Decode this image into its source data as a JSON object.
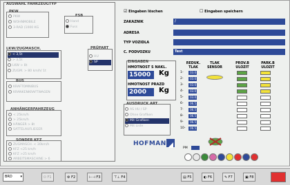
{
  "left_title": "AUSWAHL FAHRZEUGTYP",
  "pkw": {
    "title": "PKW",
    "items": [
      "PKW",
      "WOHNMOBILE",
      "3-RAD (1000 KG"
    ]
  },
  "fsb": {
    "title": "FSB",
    "items": [
      "Hand",
      "Fuss"
    ]
  },
  "lkw": {
    "title": "LKW/ZUGMASCH.",
    "items": [
      "< 3,5t",
      "> 3,5t",
      "LKW > 8t",
      "ZUGM. > 80 km/h/ 1t"
    ]
  },
  "pruefart": {
    "title": "PRÜFART",
    "items": [
      "HU",
      "SP"
    ]
  },
  "bus": {
    "title": "BUS",
    "items": [
      "KRAFTOMNIBUS",
      "KRANKENKRAFTWAGEN"
    ]
  },
  "anhaenger": {
    "title": "ANHÄNGERFAHRZEUG",
    "items": [
      "< 25km/h",
      "> 25km/h",
      "HÄNGER > 8t",
      "SATTELAUFLIEGER"
    ]
  },
  "sonder": {
    "title": "SONDER KFZ",
    "items": [
      "ZUGMASCH. < 30km/h",
      "KFZ <25 km/h",
      "KFZ >25 km/h",
      "ARBEITSMASCHINE > 6"
    ]
  },
  "checks": {
    "loeschen": "Eingaben löschen",
    "speichern": "Eingaben speichern"
  },
  "form": {
    "zakaznik_label": "ZAKAZNIK",
    "zakaznik_value": "/",
    "adresa_label": "ADRESA",
    "adresa_value": "",
    "typ_label": "TYP VOZIDLA",
    "typ_value": "",
    "podvozek_label": "C. PODVOZKU",
    "podvozek_value": "Test"
  },
  "eingaben": {
    "title": "EINGABEN",
    "hm_label": "HMOTNOST S NAKL.",
    "hm_value": "15000",
    "hm_unit": "Kg",
    "hp_label": "HMOTNOST PRAZD",
    "hp_value": "2000",
    "hp_unit": "Kg"
  },
  "ausdruck": {
    "title": "AUSDRUCK ART",
    "items": [
      "AS HU / SP",
      "Ohne Grafiken",
      "Mit Grafiken",
      "Mit Liste"
    ]
  },
  "logo": "HOFMANN",
  "grid": {
    "headers": [
      "REDUK. TLAK",
      "TLAK SENSOR",
      "PROV.B ULOZIT",
      "PARK.B ULOZIT"
    ],
    "rows": [
      {
        "n": "1-",
        "v": "03.0"
      },
      {
        "n": "2-",
        "v": "03.0"
      },
      {
        "n": "3-",
        "v": "03.0"
      },
      {
        "n": "4-",
        "v": "03.0"
      },
      {
        "n": "5-",
        "v": "03.0"
      },
      {
        "n": "6-",
        "v": "06.5"
      },
      {
        "n": "7-",
        "v": "06.5"
      },
      {
        "n": "8-",
        "v": "06.5"
      },
      {
        "n": "9-",
        "v": "06.5"
      },
      {
        "n": "10-",
        "v": "06.5"
      }
    ],
    "pm": "PM"
  },
  "taskbar": {
    "select": "BRD",
    "buttons": [
      "F1",
      "F2",
      "F3",
      "F4",
      "F5",
      "F6",
      "F7",
      "F8"
    ]
  },
  "colors": {
    "accent": "#2e4a98",
    "green": "#5ca444",
    "yellow": "#f2e23a",
    "red": "#e03030",
    "darkred": "#b02a2a"
  }
}
